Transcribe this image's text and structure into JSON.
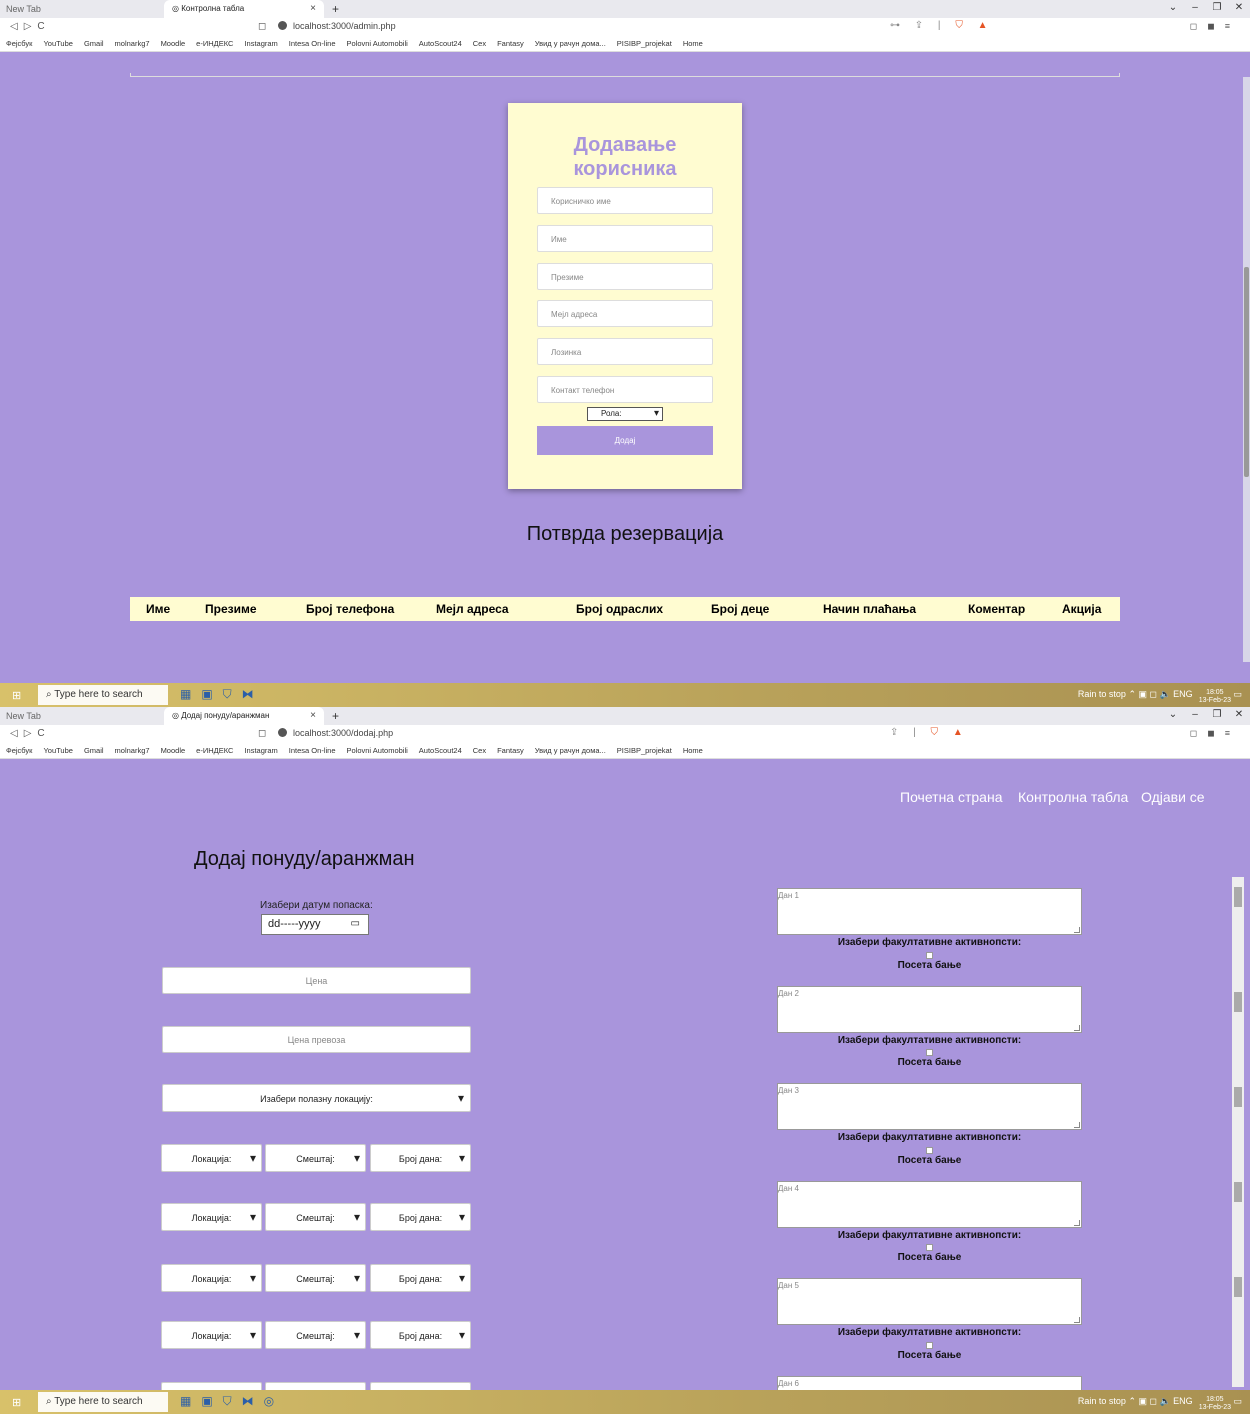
{
  "browser": {
    "newtab_label": "New Tab",
    "bookmarks": [
      "Фејсбук",
      "YouTube",
      "Gmail",
      "molnarkg7",
      "Moodle",
      "е-ИНДЕКС",
      "Instagram",
      "Intesa On-line",
      "Polovni Automobili",
      "AutoScout24",
      "Cex",
      "Fantasy",
      "Увид у рачун дома...",
      "PISIBP_projekat",
      "Home"
    ],
    "accent": "#a995dc"
  },
  "taskbar": {
    "search_placeholder": "Type here to search",
    "weather": "Rain to stop",
    "lang": "ENG",
    "time": "18:05",
    "date": "13-Feb-23"
  },
  "s1": {
    "tab_title": "Контролна табла",
    "url": "localhost:3000/admin.php",
    "form": {
      "title_line1": "Додавање",
      "title_line2": "корисника",
      "username_ph": "Корисничко име",
      "name_ph": "Име",
      "surname_ph": "Презиме",
      "email_ph": "Мејл адреса",
      "password_ph": "Лозинка",
      "phone_ph": "Контакт телефон",
      "role_value": "Рола:",
      "submit": "Додај"
    },
    "reservations": {
      "heading": "Потврда резервација",
      "columns": [
        "Име",
        "Презиме",
        "Број телефона",
        "Мејл адреса",
        "Број одраслих",
        "Број деце",
        "Начин плаћања",
        "Коментар",
        "Акција"
      ]
    }
  },
  "s2": {
    "tab_title": "Додај понуду/аранжман",
    "url": "localhost:3000/dodaj.php",
    "nav": {
      "home": "Почетна страна",
      "dashboard": "Контролна табла",
      "logout": "Одјави се"
    },
    "heading": "Додај понуду/аранжман",
    "date_label": "Изабери датум попаска:",
    "date_value": "dd-----yyyy",
    "price_ph": "Цена",
    "transport_ph": "Цена превоза",
    "departure_sel": "Изабери полазну локацију:",
    "loc_sel": "Локација:",
    "acc_sel": "Смештај:",
    "days_sel": "Број дана:",
    "days": [
      {
        "placeholder": "Дан 1",
        "fac_label": "Изабери факултативне активнопсти:",
        "activity": "Посета бање"
      },
      {
        "placeholder": "Дан 2",
        "fac_label": "Изабери факултативне активнопсти:",
        "activity": "Посета бање"
      },
      {
        "placeholder": "Дан 3",
        "fac_label": "Изабери факултативне активнопсти:",
        "activity": "Посета бање"
      },
      {
        "placeholder": "Дан 4",
        "fac_label": "Изабери факултативне активнопсти:",
        "activity": "Посета бање"
      },
      {
        "placeholder": "Дан 5",
        "fac_label": "Изабери факултативне активнопсти:",
        "activity": "Посета бање"
      },
      {
        "placeholder": "Дан 6"
      }
    ]
  }
}
